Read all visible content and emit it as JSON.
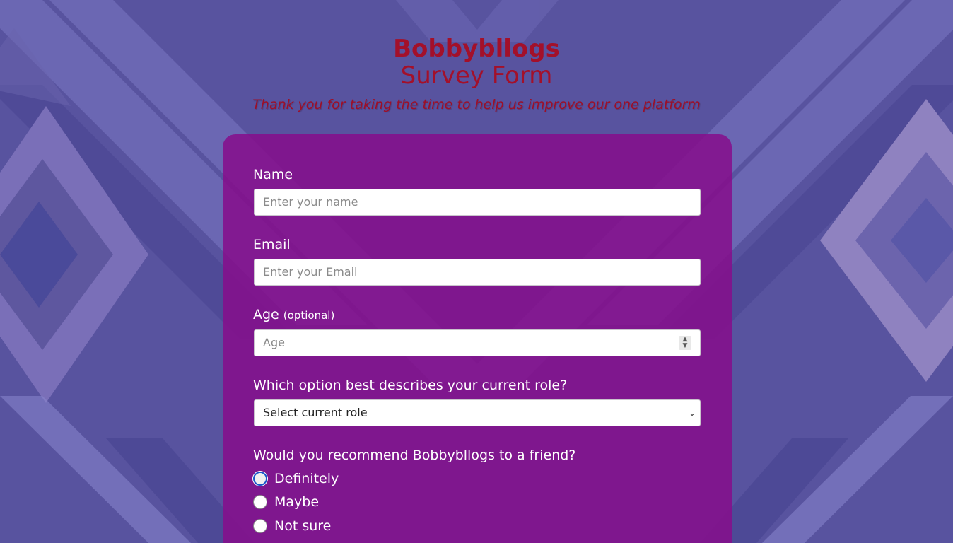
{
  "header": {
    "brand": "Bobbybllogs",
    "subtitle": "Survey Form",
    "tagline": "Thank you for taking the time to help us improve our one platform"
  },
  "form": {
    "name": {
      "label": "Name",
      "placeholder": "Enter your name"
    },
    "email": {
      "label": "Email",
      "placeholder": "Enter your Email"
    },
    "age": {
      "label": "Age",
      "optional": "(optional)",
      "placeholder": "Age"
    },
    "role": {
      "label": "Which option best describes your current role?",
      "selected": "Select current role"
    },
    "recommend": {
      "label": "Would you recommend Bobbybllogs to a friend?",
      "options": [
        "Definitely",
        "Maybe",
        "Not sure"
      ],
      "focused_index": 0
    }
  },
  "colors": {
    "title": "#a3102a",
    "card": "#860e8c",
    "background": "#5a55a3",
    "focus": "#1a56c9"
  }
}
